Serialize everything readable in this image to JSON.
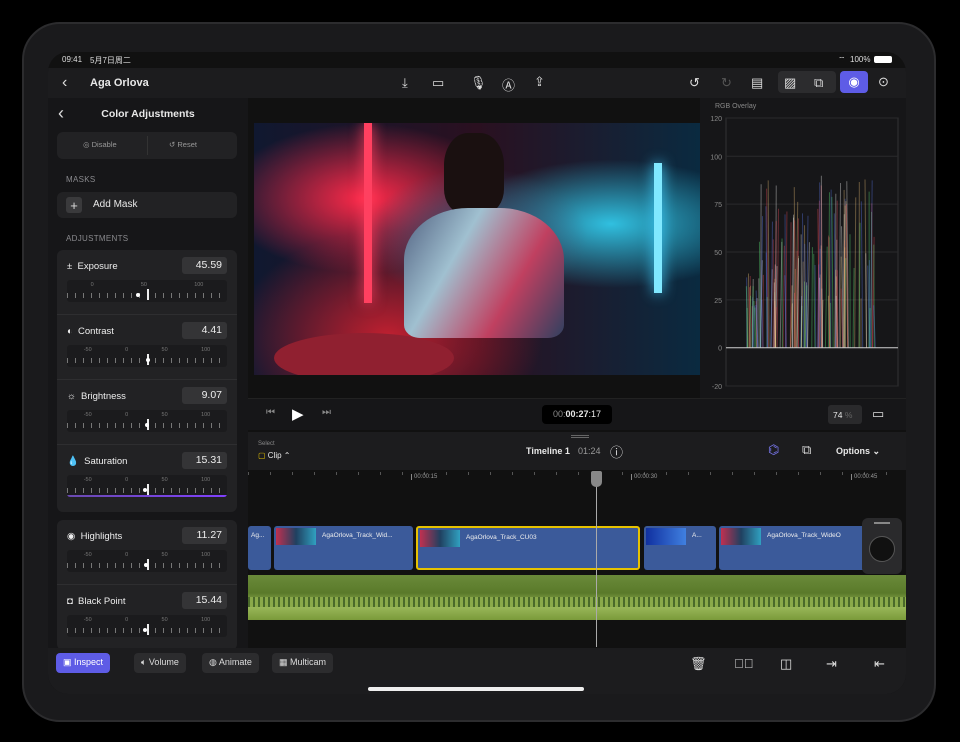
{
  "status": {
    "time": "09:41",
    "date": "5月7日周二",
    "battery": "100%"
  },
  "nav": {
    "title": "Aga Orlova",
    "center_icons": [
      "import-icon",
      "camera-icon",
      "microphone-icon",
      "pen-icon",
      "share-icon"
    ],
    "right_icons": [
      "undo-icon",
      "redo-icon",
      "viewer-layout-icon",
      "photo-icon",
      "sticker-icon",
      "inspector-icon",
      "more-icon"
    ],
    "accent": "#5e5ce6"
  },
  "panel": {
    "title": "Color Adjustments",
    "disable": "Disable",
    "reset": "Reset",
    "masks_header": "MASKS",
    "add_mask": "Add Mask",
    "adjustments_header": "ADJUSTMENTS",
    "adjustments": [
      {
        "label": "Exposure",
        "icon": "±",
        "value": "45.59",
        "ticks": [
          "0",
          "50",
          "100"
        ]
      },
      {
        "label": "Contrast",
        "icon": "◐",
        "value": "4.41",
        "ticks": [
          "-50",
          "0",
          "50",
          "100"
        ]
      },
      {
        "label": "Brightness",
        "icon": "☼",
        "value": "9.07",
        "ticks": [
          "-50",
          "0",
          "50",
          "100"
        ]
      },
      {
        "label": "Saturation",
        "icon": "💧",
        "value": "15.31",
        "ticks": [
          "-50",
          "0",
          "50",
          "100"
        ]
      }
    ],
    "adjustments2": [
      {
        "label": "Highlights",
        "icon": "◉",
        "value": "11.27",
        "ticks": [
          "-50",
          "0",
          "50",
          "100"
        ]
      },
      {
        "label": "Black Point",
        "icon": "◘",
        "value": "15.44",
        "ticks": [
          "-50",
          "0",
          "50",
          "100"
        ]
      }
    ]
  },
  "scope": {
    "title": "RGB Overlay",
    "axis": [
      "120",
      "100",
      "75",
      "50",
      "25",
      "0",
      "-20"
    ]
  },
  "transport": {
    "timecode_dim": "00:",
    "timecode": "00:27",
    "timecode_frames": ":17",
    "zoom": "74",
    "zoom_unit": "%"
  },
  "timeline": {
    "select_label": "Select",
    "select_value": "Clip",
    "name": "Timeline 1",
    "duration": "01:24",
    "options": "Options",
    "ruler": [
      "00:00:15",
      "00:00:30",
      "00:00:45"
    ],
    "clips": [
      "Ag...",
      "AgaOrlova_Track_Wid...",
      "AgaOrlova_Track_CU03",
      "A...",
      "AgaOrlova_Track_WideO"
    ]
  },
  "toolbar": {
    "inspect": "Inspect",
    "volume": "Volume",
    "animate": "Animate",
    "multicam": "Multicam"
  }
}
